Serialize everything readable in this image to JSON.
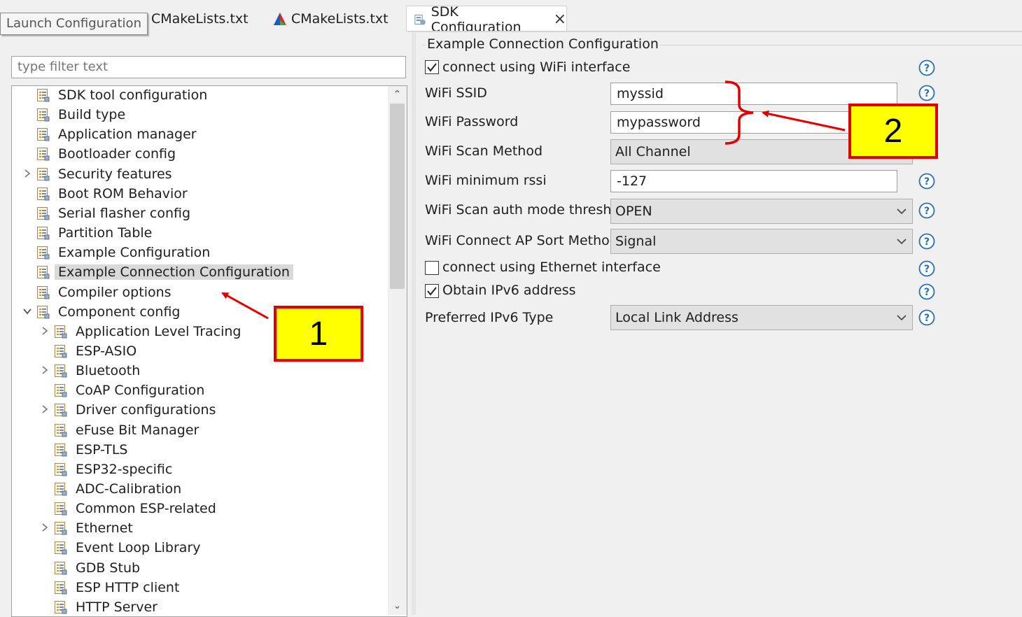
{
  "tooltip": {
    "text": "Launch Configuration"
  },
  "tabs": [
    {
      "label": "CMakeLists.txt"
    },
    {
      "label": "CMakeLists.txt"
    },
    {
      "label": "SDK Configuration",
      "close": "×",
      "active": true
    }
  ],
  "filter": {
    "placeholder": "type filter text"
  },
  "tree": {
    "items": [
      {
        "label": "SDK tool configuration",
        "level": 0,
        "expander": ""
      },
      {
        "label": "Build type",
        "level": 0,
        "expander": ""
      },
      {
        "label": "Application manager",
        "level": 0,
        "expander": ""
      },
      {
        "label": "Bootloader config",
        "level": 0,
        "expander": ""
      },
      {
        "label": "Security features",
        "level": 0,
        "expander": "collapsed"
      },
      {
        "label": "Boot ROM Behavior",
        "level": 0,
        "expander": ""
      },
      {
        "label": "Serial flasher config",
        "level": 0,
        "expander": ""
      },
      {
        "label": "Partition Table",
        "level": 0,
        "expander": ""
      },
      {
        "label": "Example Configuration",
        "level": 0,
        "expander": ""
      },
      {
        "label": "Example Connection Configuration",
        "level": 0,
        "expander": "",
        "selected": true
      },
      {
        "label": "Compiler options",
        "level": 0,
        "expander": ""
      },
      {
        "label": "Component config",
        "level": 0,
        "expander": "expanded"
      },
      {
        "label": "Application Level Tracing",
        "level": 1,
        "expander": "collapsed"
      },
      {
        "label": "ESP-ASIO",
        "level": 1,
        "expander": ""
      },
      {
        "label": "Bluetooth",
        "level": 1,
        "expander": "collapsed"
      },
      {
        "label": "CoAP Configuration",
        "level": 1,
        "expander": ""
      },
      {
        "label": "Driver configurations",
        "level": 1,
        "expander": "collapsed"
      },
      {
        "label": "eFuse Bit Manager",
        "level": 1,
        "expander": ""
      },
      {
        "label": "ESP-TLS",
        "level": 1,
        "expander": ""
      },
      {
        "label": "ESP32-specific",
        "level": 1,
        "expander": ""
      },
      {
        "label": "ADC-Calibration",
        "level": 1,
        "expander": ""
      },
      {
        "label": "Common ESP-related",
        "level": 1,
        "expander": ""
      },
      {
        "label": "Ethernet",
        "level": 1,
        "expander": "collapsed"
      },
      {
        "label": "Event Loop Library",
        "level": 1,
        "expander": ""
      },
      {
        "label": "GDB Stub",
        "level": 1,
        "expander": ""
      },
      {
        "label": "ESP HTTP client",
        "level": 1,
        "expander": ""
      },
      {
        "label": "HTTP Server",
        "level": 1,
        "expander": ""
      }
    ]
  },
  "config": {
    "group_title": "Example Connection Configuration",
    "wifi_checkbox": {
      "label": "connect using WiFi interface",
      "checked": true
    },
    "wifi_ssid": {
      "label": "WiFi SSID",
      "value": "myssid"
    },
    "wifi_password": {
      "label": "WiFi Password",
      "value": "mypassword"
    },
    "wifi_scan_method": {
      "label": "WiFi Scan Method",
      "value": "All Channel"
    },
    "wifi_min_rssi": {
      "label": "WiFi minimum rssi",
      "value": "-127"
    },
    "wifi_auth_threshold": {
      "label": "WiFi Scan auth mode threshold",
      "value": "OPEN"
    },
    "wifi_sort_method": {
      "label": "WiFi Connect AP Sort Method",
      "value": "Signal"
    },
    "ethernet_checkbox": {
      "label": "connect using Ethernet interface",
      "checked": false
    },
    "ipv6_checkbox": {
      "label": "Obtain IPv6 address",
      "checked": true
    },
    "ipv6_type": {
      "label": "Preferred IPv6 Type",
      "value": "Local Link Address"
    }
  },
  "annotations": {
    "callout1": "1",
    "callout2": "2"
  },
  "colors": {
    "annotation_red": "#e00000",
    "annotation_yellow": "#ffff00",
    "selection": "#d9d9d9",
    "help_icon": "#2a6fb0"
  }
}
